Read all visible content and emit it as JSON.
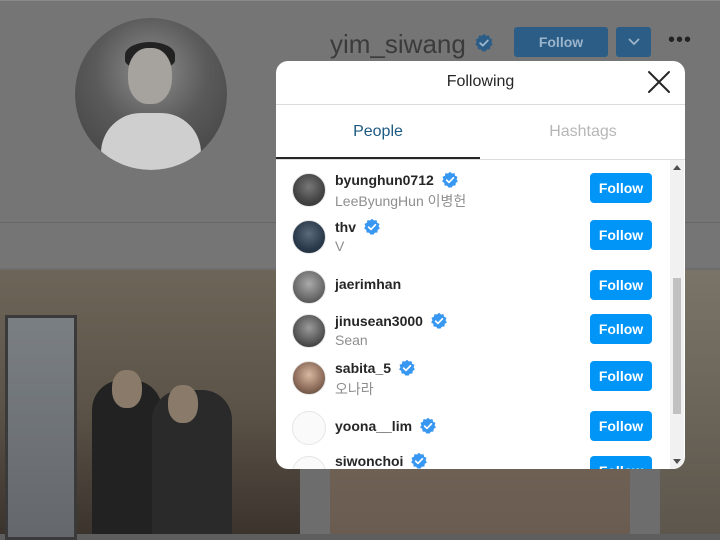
{
  "profile": {
    "username": "yim_siwang",
    "follow_label": "Follow",
    "more_label": "•••"
  },
  "modal": {
    "title": "Following",
    "tabs": [
      {
        "label": "People",
        "active": true
      },
      {
        "label": "Hashtags",
        "active": false
      }
    ],
    "accounts": [
      {
        "username": "byunghun0712",
        "subtitle": "LeeByungHun 이병헌",
        "verified": true,
        "button": "Follow"
      },
      {
        "username": "thv",
        "subtitle": "V",
        "verified": true,
        "button": "Follow"
      },
      {
        "username": "jaerimhan",
        "subtitle": "",
        "verified": false,
        "button": "Follow"
      },
      {
        "username": "jinusean3000",
        "subtitle": "Sean",
        "verified": true,
        "button": "Follow"
      },
      {
        "username": "sabita_5",
        "subtitle": "오나라",
        "verified": true,
        "button": "Follow"
      },
      {
        "username": "yoona__lim",
        "subtitle": "",
        "verified": true,
        "button": "Follow"
      },
      {
        "username": "siwonchoi",
        "subtitle": "",
        "verified": true,
        "button": "Follow"
      }
    ]
  },
  "colors": {
    "accent": "#0095f6",
    "verified": "#3897f0",
    "active_tab": "#1c5a82"
  },
  "icons": {
    "verified": "verified-badge-icon",
    "close": "close-icon",
    "dropdown": "chevron-down-icon",
    "more": "more-options-icon"
  }
}
